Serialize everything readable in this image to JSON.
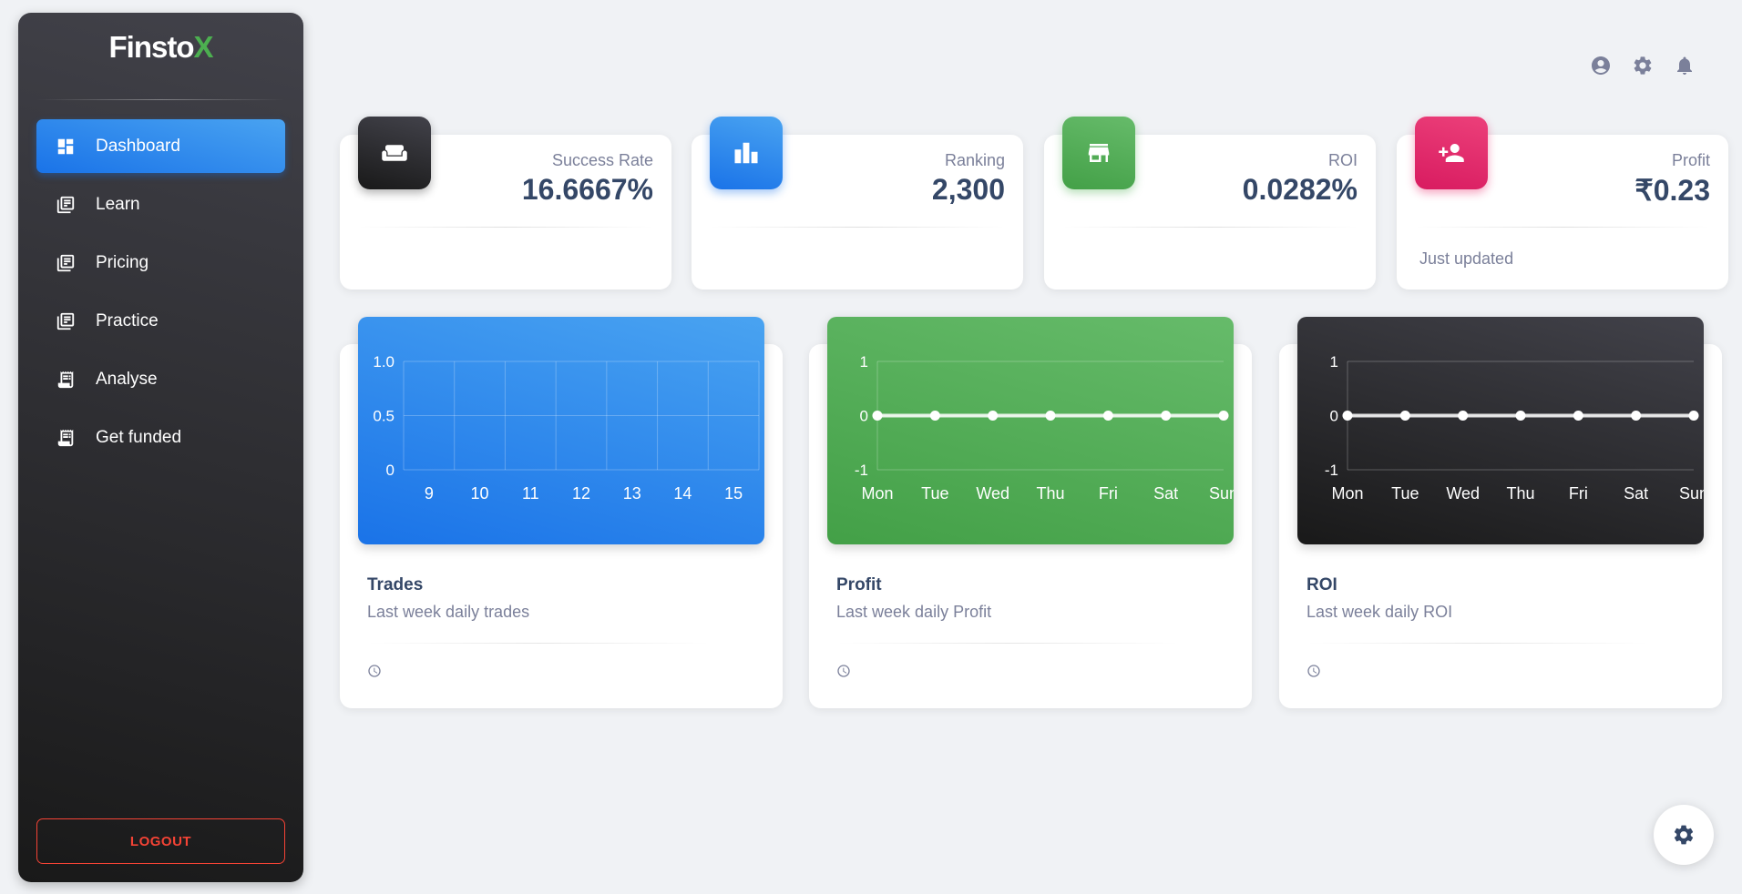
{
  "brand": {
    "name_main": "Finsto",
    "name_accent": "X"
  },
  "sidebar": {
    "items": [
      {
        "label": "Dashboard",
        "icon": "dashboard-icon",
        "active": true
      },
      {
        "label": "Learn",
        "icon": "library-icon"
      },
      {
        "label": "Pricing",
        "icon": "library-icon"
      },
      {
        "label": "Practice",
        "icon": "library-icon"
      },
      {
        "label": "Analyse",
        "icon": "receipt-icon"
      },
      {
        "label": "Get funded",
        "icon": "receipt-icon"
      }
    ],
    "logout_label": "LOGOUT"
  },
  "header_icons": [
    "account-icon",
    "settings-icon",
    "notifications-icon"
  ],
  "stats": [
    {
      "label": "Success Rate",
      "value": "16.6667%",
      "footer": "",
      "icon": "weekend-icon",
      "color": "#191919"
    },
    {
      "label": "Ranking",
      "value": "2,300",
      "footer": "",
      "icon": "leaderboard-icon",
      "color": "#1a73e8"
    },
    {
      "label": "ROI",
      "value": "0.0282%",
      "footer": "",
      "icon": "store-icon",
      "color": "#43a047"
    },
    {
      "label": "Profit",
      "value": "₹0.23",
      "footer": "Just updated",
      "icon": "person-add-icon",
      "color": "#d81b60"
    }
  ],
  "charts": [
    {
      "title": "Trades",
      "subtitle": "Last week daily trades",
      "footer": ""
    },
    {
      "title": "Profit",
      "subtitle": "Last week daily Profit",
      "footer": ""
    },
    {
      "title": "ROI",
      "subtitle": "Last week daily ROI",
      "footer": ""
    }
  ],
  "chart_data": [
    {
      "type": "bar",
      "categories": [
        "9",
        "10",
        "11",
        "12",
        "13",
        "14",
        "15"
      ],
      "values": [
        0,
        0,
        0,
        0,
        0,
        0,
        0
      ],
      "ylim": [
        0,
        1
      ],
      "yticks": [
        "0",
        "0.5",
        "1.0"
      ],
      "grid": true
    },
    {
      "type": "line",
      "categories": [
        "Mon",
        "Tue",
        "Wed",
        "Thu",
        "Fri",
        "Sat",
        "Sun"
      ],
      "values": [
        0,
        0,
        0,
        0,
        0,
        0,
        0
      ],
      "ylim": [
        -1,
        1
      ],
      "yticks": [
        "-1",
        "0",
        "1"
      ],
      "grid": true
    },
    {
      "type": "line",
      "categories": [
        "Mon",
        "Tue",
        "Wed",
        "Thu",
        "Fri",
        "Sat",
        "Sun"
      ],
      "values": [
        0,
        0,
        0,
        0,
        0,
        0,
        0
      ],
      "ylim": [
        -1,
        1
      ],
      "yticks": [
        "-1",
        "0",
        "1"
      ],
      "grid": true
    }
  ],
  "colors": {
    "blue": "#1a73e8",
    "green": "#43a047",
    "dark": "#191919",
    "pink": "#d81b60",
    "danger": "#f44335"
  }
}
